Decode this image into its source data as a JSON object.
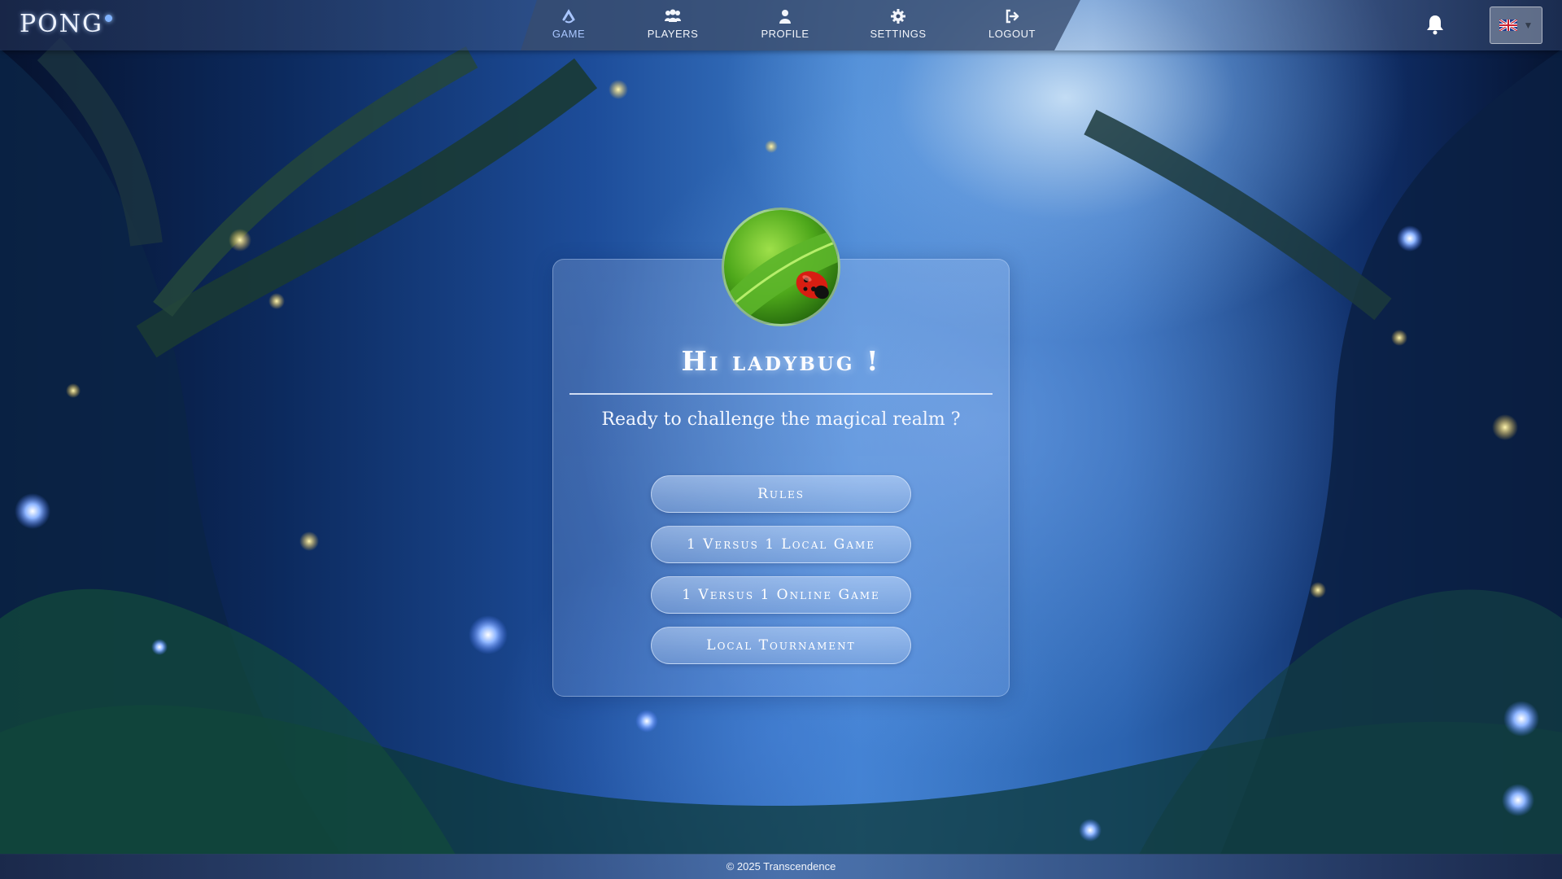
{
  "app": {
    "logo": "PONG"
  },
  "nav": {
    "items": [
      {
        "label": "GAME",
        "icon": "game-icon",
        "active": true
      },
      {
        "label": "PLAYERS",
        "icon": "players-icon"
      },
      {
        "label": "PROFILE",
        "icon": "user-icon"
      },
      {
        "label": "SETTINGS",
        "icon": "gear-icon"
      },
      {
        "label": "LOGOUT",
        "icon": "logout-icon"
      }
    ],
    "notifications_icon": "bell-icon",
    "language": {
      "selected": "en-GB",
      "icon": "uk-flag-icon"
    }
  },
  "main": {
    "greeting": "Hi ladybug !",
    "subtitle": "Ready to challenge the magical realm ?",
    "avatar_icon": "ladybug-avatar",
    "buttons": [
      {
        "label": "Rules"
      },
      {
        "label": "1 Versus 1 Local Game"
      },
      {
        "label": "1 Versus 1 Online Game"
      },
      {
        "label": "Local Tournament"
      }
    ]
  },
  "footer": {
    "text": "© 2025 Transcendence"
  },
  "colors": {
    "accent": "#a9c6ff",
    "text": "#ffffff",
    "panel": "#37496e"
  }
}
